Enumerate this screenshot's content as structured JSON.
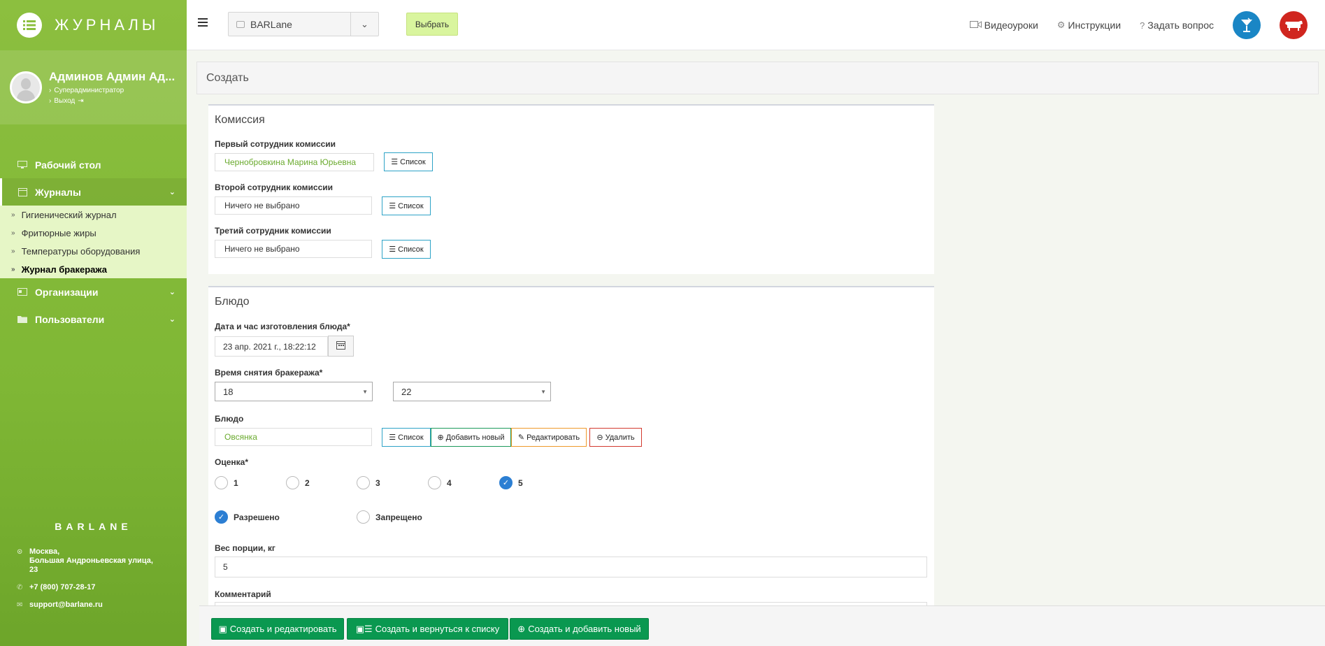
{
  "app": {
    "title": "ЖУРНАЛЫ"
  },
  "user": {
    "name": "Админов Админ Ад...",
    "role": "Суперадминистратор",
    "logout": "Выход"
  },
  "sidebar": {
    "items": [
      {
        "label": "Рабочий стол",
        "icon": "monitor-icon"
      },
      {
        "label": "Журналы",
        "icon": "calendar-icon"
      },
      {
        "label": "Организации",
        "icon": "id-card-icon"
      },
      {
        "label": "Пользователи",
        "icon": "folder-icon"
      }
    ],
    "journals": [
      {
        "label": "Гигиенический журнал"
      },
      {
        "label": "Фритюрные жиры"
      },
      {
        "label": "Температуры оборудования"
      },
      {
        "label": "Журнал бракеража"
      }
    ]
  },
  "footer": {
    "brand": "BARLANE",
    "address_line1": "Москва,",
    "address_line2": "Большая Андроньевская улица,",
    "address_line3": "23",
    "phone": "+7 (800) 707-28-17",
    "email": "support@barlane.ru"
  },
  "header": {
    "org_value": "BARLane",
    "choose_label": "Выбрать",
    "video_label": "Видеоуроки",
    "instructions_label": "Инструкции",
    "ask_label": "Задать вопрос"
  },
  "page": {
    "title": "Создать"
  },
  "commission": {
    "title": "Комиссия",
    "first_label": "Первый сотрудник комиссии",
    "first_value": "Чернобровкина Марина Юрьевна",
    "second_label": "Второй сотрудник комиссии",
    "second_value": "Ничего не выбрано",
    "third_label": "Третий сотрудник комиссии",
    "third_value": "Ничего не выбрано",
    "list_label": "Список"
  },
  "dish": {
    "title": "Блюдо",
    "datetime_label": "Дата и час изготовления блюда*",
    "datetime_value": "23 апр. 2021 г., 18:22:12",
    "time_label": "Время снятия бракеража*",
    "hour_value": "18",
    "minute_value": "22",
    "dish_label": "Блюдо",
    "dish_value": "Овсянка",
    "list_label": "Список",
    "add_label": "Добавить новый",
    "edit_label": "Редактировать",
    "delete_label": "Удалить",
    "rating_label": "Оценка*",
    "ratings": [
      "1",
      "2",
      "3",
      "4",
      "5"
    ],
    "rating_selected": "5",
    "allowed_label": "Разрешено",
    "forbidden_label": "Запрещено",
    "allowed_selected": true,
    "weight_label": "Вес порции, кг",
    "weight_value": "5",
    "comment_label": "Комментарий"
  },
  "actions": {
    "create_edit": "Создать и редактировать",
    "create_back": "Создать и вернуться к списку",
    "create_new": "Создать и добавить новый"
  },
  "colors": {
    "sidebar": "#8cbf3f",
    "submenu": "#e6f6c6",
    "primary_green": "#0a9850",
    "info": "#2ea3c7",
    "warning": "#ef9a2b",
    "danger": "#d33a2f",
    "checked": "#2c7fd3"
  }
}
